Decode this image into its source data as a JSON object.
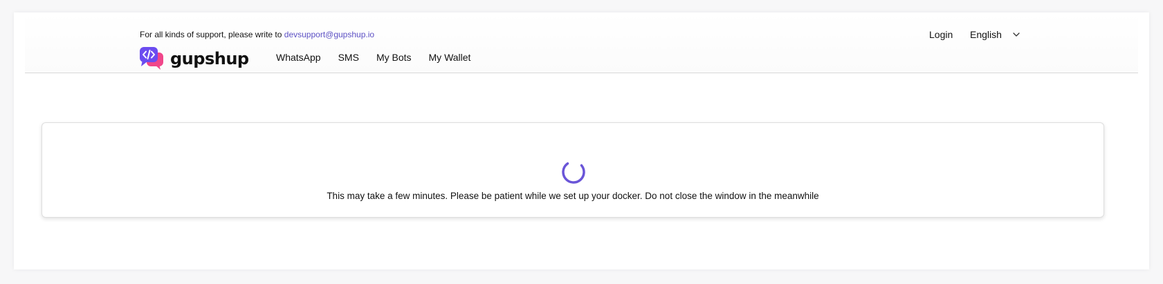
{
  "header": {
    "support_prefix": "For all kinds of support, please write to",
    "support_email": "devsupport@gupshup.io",
    "logo_text": "gupshup",
    "nav": {
      "whatsapp": "WhatsApp",
      "sms": "SMS",
      "my_bots": "My Bots",
      "my_wallet": "My Wallet"
    },
    "login_label": "Login",
    "language": "English"
  },
  "main": {
    "loading_message": "This may take a few minutes. Please be patient while we set up your docker. Do not close the window in the meanwhile"
  },
  "colors": {
    "accent": "#6a55d8",
    "logo_purple": "#6b4cf0",
    "logo_pink": "#f0468a",
    "link": "#5b4fc4"
  },
  "icons": {
    "logo": "gupshup-chat-code-logo",
    "language_dropdown": "chevron-down-icon",
    "spinner": "loading-spinner-icon"
  }
}
